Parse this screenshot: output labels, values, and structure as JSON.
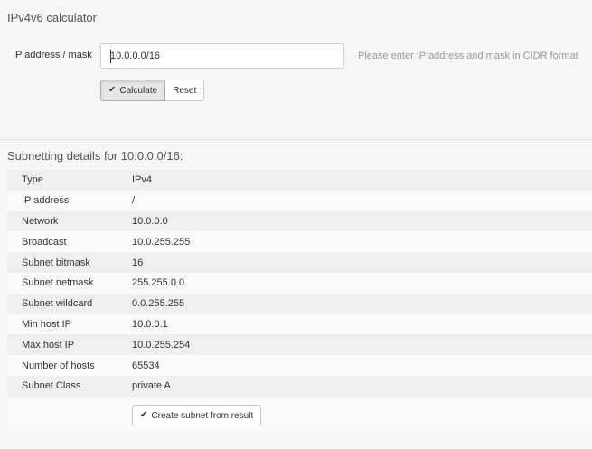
{
  "page": {
    "title": "IPv4v6 calculator"
  },
  "form": {
    "label": "IP address / mask",
    "input_value": "10.0.0.0/16",
    "help": "Please enter IP address and mask in CIDR format",
    "calculate_label": "Calculate",
    "reset_label": "Reset"
  },
  "details": {
    "title": "Subnetting details for 10.0.0.0/16:",
    "rows": [
      {
        "key": "Type",
        "value": "IPv4"
      },
      {
        "key": "IP address",
        "value": "/"
      },
      {
        "key": "Network",
        "value": "10.0.0.0"
      },
      {
        "key": "Broadcast",
        "value": "10.0.255.255"
      },
      {
        "key": "Subnet bitmask",
        "value": "16"
      },
      {
        "key": "Subnet netmask",
        "value": "255.255.0.0"
      },
      {
        "key": "Subnet wildcard",
        "value": "0.0.255.255"
      },
      {
        "key": "Min host IP",
        "value": "10.0.0.1"
      },
      {
        "key": "Max host IP",
        "value": "10.0.255.254"
      },
      {
        "key": "Number of hosts",
        "value": "65534"
      },
      {
        "key": "Subnet Class",
        "value": "private A"
      }
    ],
    "create_label": "Create subnet from result"
  },
  "icons": {
    "check": "check-icon"
  }
}
